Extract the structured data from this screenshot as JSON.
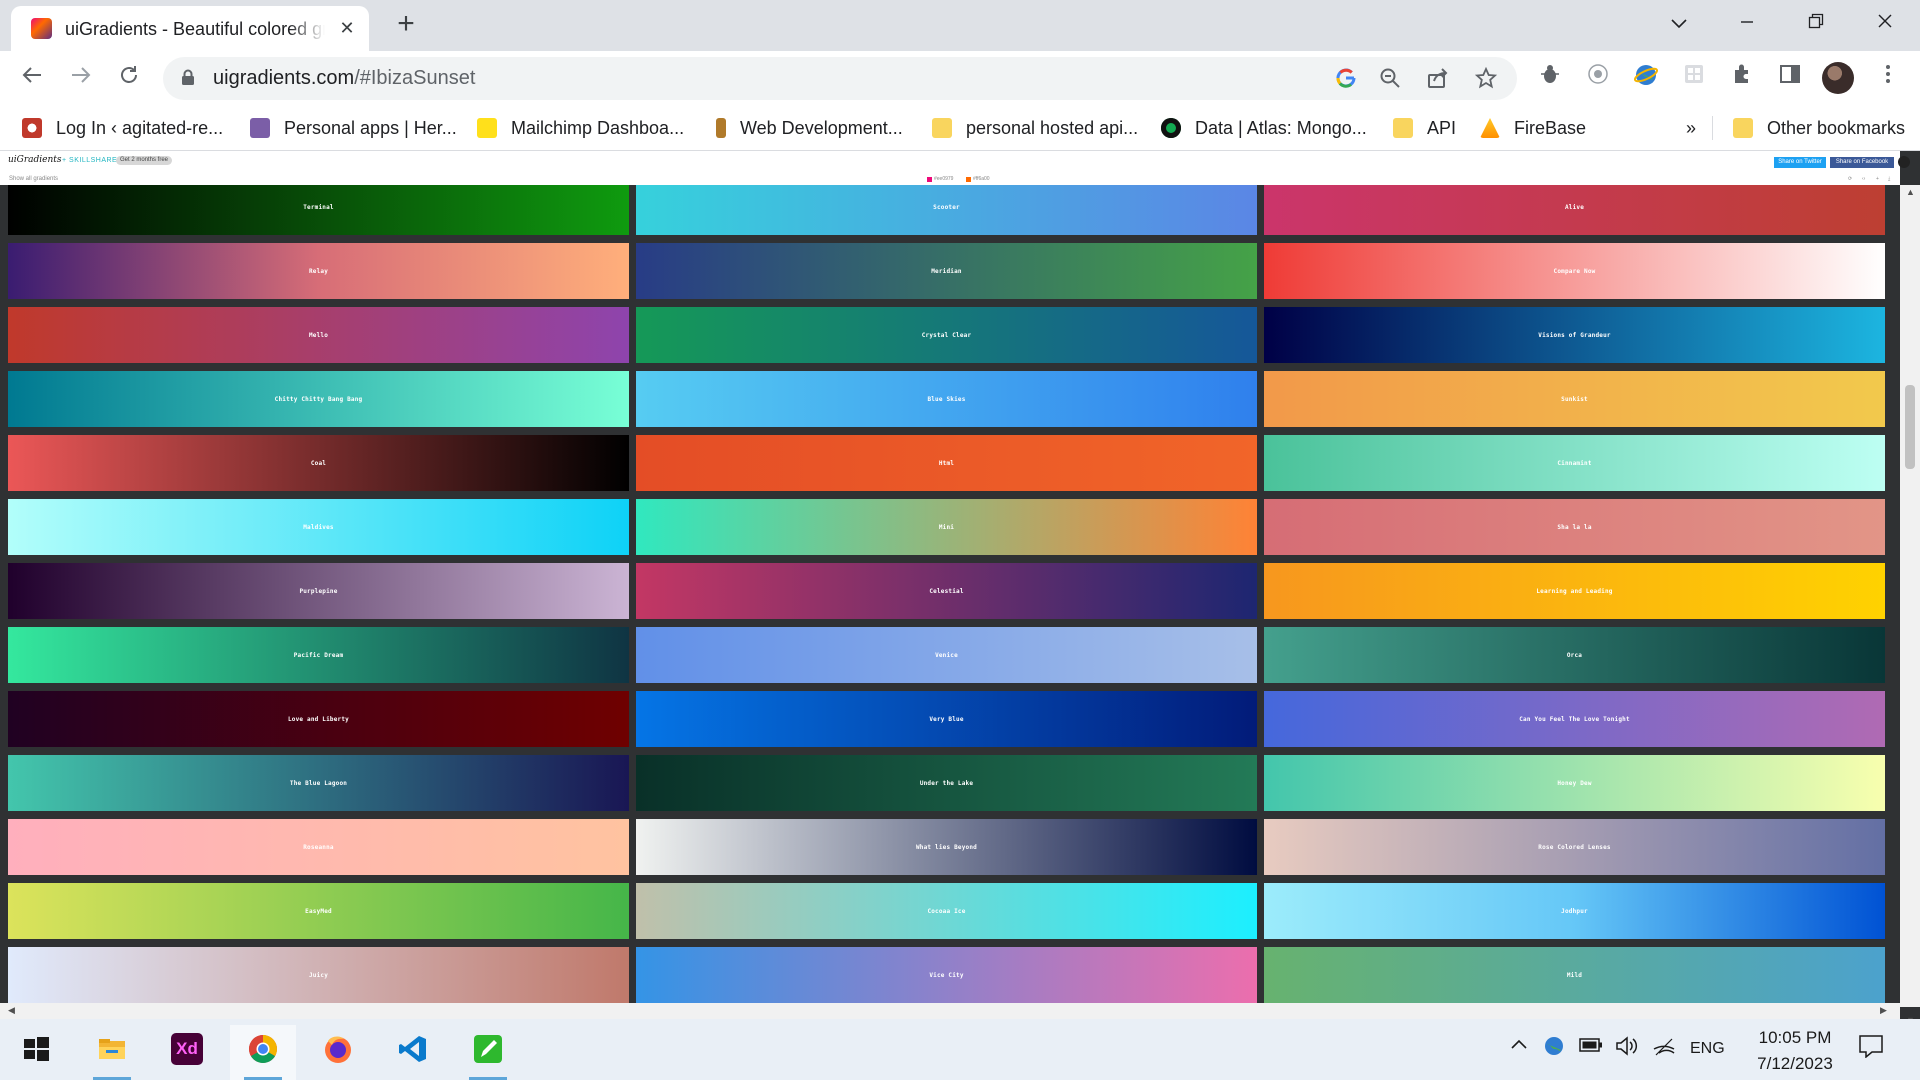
{
  "browser": {
    "tab_title": "uiGradients - Beautiful colored gradients",
    "tab_close": "✕",
    "new_tab": "+",
    "url_host": "uigradients.com",
    "url_path": "/#IbizaSunset",
    "bookmarks": [
      {
        "label": "Log In ‹ agitated-re...",
        "icon": "wordpress-icon",
        "color": "#c0392b"
      },
      {
        "label": "Personal apps | Her...",
        "icon": "heroku-icon",
        "color": "#7b5ea7"
      },
      {
        "label": "Mailchimp Dashboa...",
        "icon": "mailchimp-icon",
        "color": "#ffe01b"
      },
      {
        "label": "Web Development...",
        "icon": "page-icon",
        "color": "#b07a2a"
      },
      {
        "label": "personal hosted api...",
        "icon": "folder-icon",
        "color": "#f9d55e"
      },
      {
        "label": "Data | Atlas: Mongo...",
        "icon": "mongodb-icon",
        "color": "#13aa52"
      },
      {
        "label": "API",
        "icon": "folder-icon",
        "color": "#f9d55e"
      },
      {
        "label": "FireBase",
        "icon": "firebase-icon",
        "color": "#ffa000"
      }
    ],
    "bookmarks_overflow": "»",
    "other_bookmarks": "Other bookmarks"
  },
  "site": {
    "logo": "uiGradients",
    "logo_sub": "+ SKILLSHARE",
    "logo_pill": "Get 2 months free",
    "share_twitter": "Share on Twitter",
    "share_facebook": "Share on Facebook",
    "show_all": "Show all gradients",
    "current_from": "#ee0979",
    "current_to": "#ff6a00",
    "current_from_label": "#ee0979",
    "current_to_label": "#ff6a00"
  },
  "gradients": [
    {
      "name": "Terminal",
      "colors": [
        "#000000",
        "#0f9b0f"
      ]
    },
    {
      "name": "Scooter",
      "colors": [
        "#36d1dc",
        "#5b86e5"
      ]
    },
    {
      "name": "Alive",
      "colors": [
        "#cb356b",
        "#bd3f32"
      ]
    },
    {
      "name": "Relay",
      "colors": [
        "#3a1c71",
        "#d76d77",
        "#ffaf7b"
      ]
    },
    {
      "name": "Meridian",
      "colors": [
        "#283c86",
        "#45a247"
      ]
    },
    {
      "name": "Compare Now",
      "colors": [
        "#ef3b36",
        "#ffffff"
      ]
    },
    {
      "name": "Mello",
      "colors": [
        "#c0392b",
        "#8e44ad"
      ]
    },
    {
      "name": "Crystal Clear",
      "colors": [
        "#159957",
        "#155799"
      ]
    },
    {
      "name": "Visions of Grandeur",
      "colors": [
        "#000046",
        "#1cb5e0"
      ]
    },
    {
      "name": "Chitty Chitty Bang Bang",
      "colors": [
        "#007991",
        "#78ffd6"
      ]
    },
    {
      "name": "Blue Skies",
      "colors": [
        "#56ccf2",
        "#2f80ed"
      ]
    },
    {
      "name": "Sunkist",
      "colors": [
        "#f2994a",
        "#f2c94c"
      ]
    },
    {
      "name": "Coal",
      "colors": [
        "#eb5757",
        "#000000"
      ]
    },
    {
      "name": "Html",
      "colors": [
        "#e44d26",
        "#f16529"
      ]
    },
    {
      "name": "Cinnamint",
      "colors": [
        "#4ac29a",
        "#bdfff3"
      ]
    },
    {
      "name": "Maldives",
      "colors": [
        "#b2fefa",
        "#0ed2f7"
      ]
    },
    {
      "name": "Mini",
      "colors": [
        "#30e8bf",
        "#ff8235"
      ]
    },
    {
      "name": "Sha la la",
      "colors": [
        "#d66d75",
        "#e29587"
      ]
    },
    {
      "name": "Purplepine",
      "colors": [
        "#20002c",
        "#cbb4d4"
      ]
    },
    {
      "name": "Celestial",
      "colors": [
        "#c33764",
        "#1d2671"
      ]
    },
    {
      "name": "Learning and Leading",
      "colors": [
        "#f7971e",
        "#ffd200"
      ]
    },
    {
      "name": "Pacific Dream",
      "colors": [
        "#34e89e",
        "#0f3443"
      ]
    },
    {
      "name": "Venice",
      "colors": [
        "#6190e8",
        "#a7bfe8"
      ]
    },
    {
      "name": "Orca",
      "colors": [
        "#44a08d",
        "#093637"
      ]
    },
    {
      "name": "Love and Liberty",
      "colors": [
        "#200122",
        "#6f0000"
      ]
    },
    {
      "name": "Very Blue",
      "colors": [
        "#0575e6",
        "#021b79"
      ]
    },
    {
      "name": "Can You Feel The Love Tonight",
      "colors": [
        "#4568dc",
        "#b06ab3"
      ]
    },
    {
      "name": "The Blue Lagoon",
      "colors": [
        "#43c6ac",
        "#191654"
      ]
    },
    {
      "name": "Under the Lake",
      "colors": [
        "#093028",
        "#237a57"
      ]
    },
    {
      "name": "Honey Dew",
      "colors": [
        "#43c6ac",
        "#f8ffae"
      ]
    },
    {
      "name": "Roseanna",
      "colors": [
        "#ffafbd",
        "#ffc3a0"
      ]
    },
    {
      "name": "What lies Beyond",
      "colors": [
        "#f0f2f0",
        "#000c40"
      ]
    },
    {
      "name": "Rose Colored Lenses",
      "colors": [
        "#e8cbc0",
        "#636fa4"
      ]
    },
    {
      "name": "EasyMed",
      "colors": [
        "#dce35b",
        "#45b649"
      ]
    },
    {
      "name": "Cocoaa Ice",
      "colors": [
        "#c0c0aa",
        "#1cefff"
      ]
    },
    {
      "name": "Jodhpur",
      "colors": [
        "#9cecfb",
        "#65c7f7",
        "#0052d4"
      ]
    },
    {
      "name": "Juicy",
      "colors": [
        "#e0eafc",
        "#c0796b"
      ]
    },
    {
      "name": "Vice City",
      "colors": [
        "#3494e6",
        "#ec6ead"
      ]
    },
    {
      "name": "Mild",
      "colors": [
        "#67b26f",
        "#4ca2cd"
      ]
    }
  ],
  "next_row_colors": [
    "#f4762a",
    "#e2215e",
    "#9b59b6"
  ],
  "taskbar": {
    "apps": [
      {
        "name": "start-menu-icon"
      },
      {
        "name": "file-explorer-icon"
      },
      {
        "name": "adobe-xd-icon",
        "label": "Xd"
      },
      {
        "name": "chrome-icon"
      },
      {
        "name": "firefox-icon"
      },
      {
        "name": "vscode-icon"
      },
      {
        "name": "edit-app-icon"
      }
    ],
    "language": "ENG",
    "time": "10:05 PM",
    "date": "7/12/2023"
  }
}
